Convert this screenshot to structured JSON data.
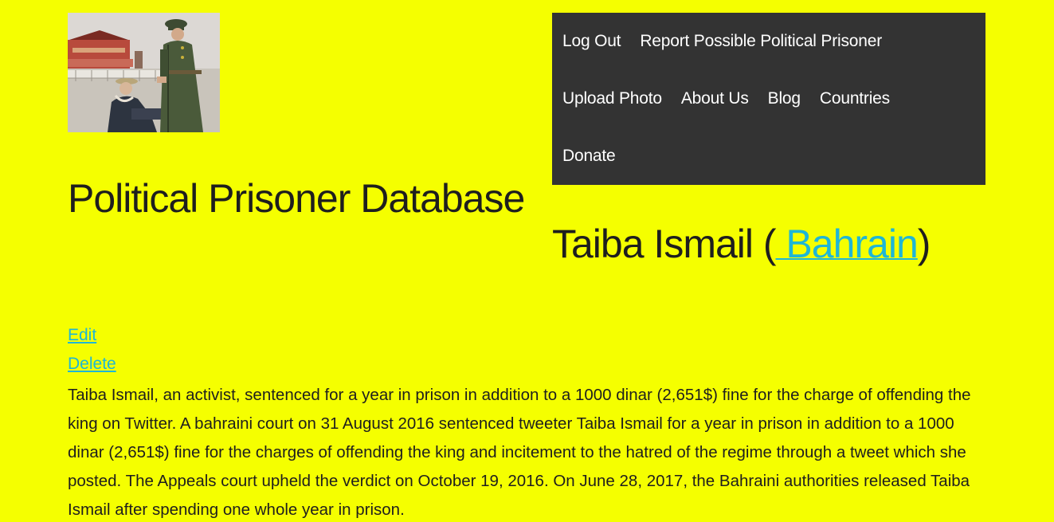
{
  "header": {
    "logo_icon": "prisoner-photo-icon"
  },
  "nav": {
    "items": [
      {
        "label": "Log Out"
      },
      {
        "label": "Report Possible Political Prisoner"
      },
      {
        "label": "Upload Photo"
      },
      {
        "label": "About Us"
      },
      {
        "label": "Blog"
      },
      {
        "label": "Countries"
      },
      {
        "label": "Donate"
      }
    ]
  },
  "site": {
    "title": "Political Prisoner Database"
  },
  "prisoner": {
    "name_prefix": "Taiba Ismail (",
    "country": " Bahrain",
    "name_suffix": ")",
    "description": "Taiba Ismail, an activist, sentenced for a year in prison in addition to a 1000 dinar (2,651$) fine for the charge of offending the king on Twitter. A bahraini court on 31 August 2016 sentenced tweeter Taiba Ismail for a year in prison in addition to a 1000 dinar (2,651$) fine for the charges of offending the king and incitement to the hatred of the regime through a tweet which she posted. The Appeals court upheld the verdict on October 19, 2016. On June 28, 2017, the Bahraini authorities released Taiba Ismail after spending one whole year in prison."
  },
  "actions": {
    "edit_label": "Edit",
    "delete_label": "Delete"
  },
  "colors": {
    "background": "#f5ff00",
    "nav_background": "#333333",
    "link": "#1fb6d6",
    "text": "#1e1e1e"
  }
}
